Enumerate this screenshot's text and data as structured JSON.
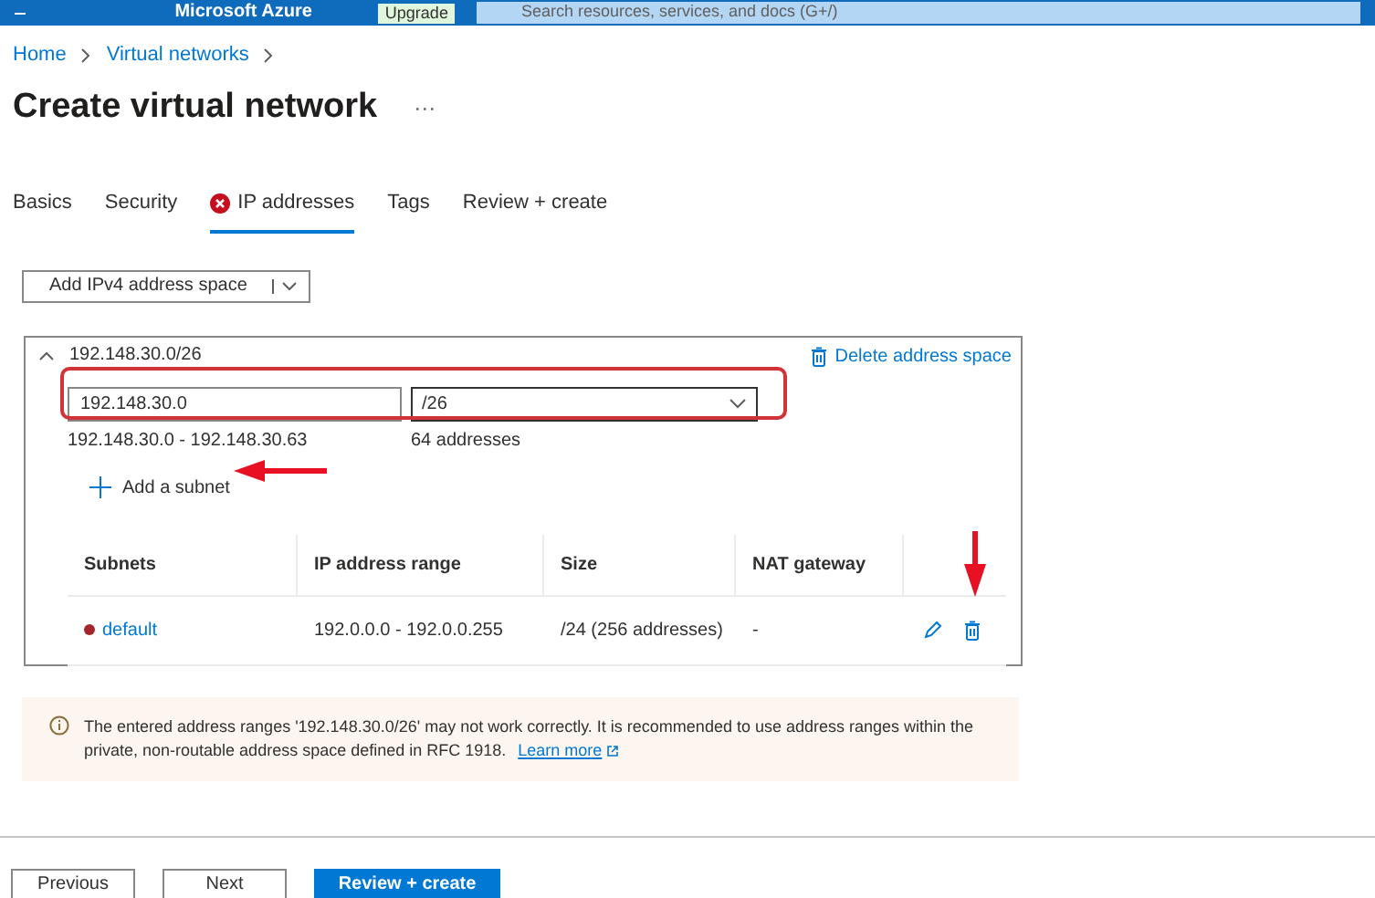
{
  "top_bar": {
    "brand": "Microsoft Azure",
    "upgrade": "Upgrade",
    "search": {
      "placeholder": "Search resources, services, and docs (G+/)"
    }
  },
  "breadcrumb": [
    "Home",
    "Virtual networks"
  ],
  "title": "Create virtual network",
  "more": "···",
  "tabs": [
    {
      "label": "Basics",
      "selected": false,
      "error": false
    },
    {
      "label": "Security",
      "selected": false,
      "error": false
    },
    {
      "label": "IP addresses",
      "selected": true,
      "error": true
    },
    {
      "label": "Tags",
      "selected": false,
      "error": false
    },
    {
      "label": "Review + create",
      "selected": false,
      "error": false
    }
  ],
  "add_space_button": "Add IPv4 address space",
  "address_space": {
    "expanded": true,
    "title": "192.148.30.0/26",
    "delete": "Delete address space",
    "address": {
      "value": "192.148.30.0"
    },
    "prefix": {
      "value": "/26"
    },
    "range": "192.148.30.0 - 192.148.30.63",
    "count": "64 addresses",
    "add_subnet": "Add a subnet",
    "table": {
      "columns": [
        "Subnets",
        "IP address range",
        "Size",
        "NAT gateway"
      ],
      "rows": [
        {
          "name": "default",
          "error": true,
          "range": "192.0.0.0 - 192.0.0.255",
          "size": "/24 (256 addresses)",
          "nat": "-"
        }
      ]
    }
  },
  "warning": {
    "text": "The entered address ranges '192.148.30.0/26' may not work correctly. It is recommended to use address ranges within the private, non-routable address space defined in RFC 1918.",
    "link": "Learn more"
  },
  "footer": {
    "buttons": [
      {
        "label": "Previous",
        "kind": "secondary"
      },
      {
        "label": "Next",
        "kind": "secondary"
      },
      {
        "label": "Review + create",
        "kind": "primary"
      }
    ]
  }
}
